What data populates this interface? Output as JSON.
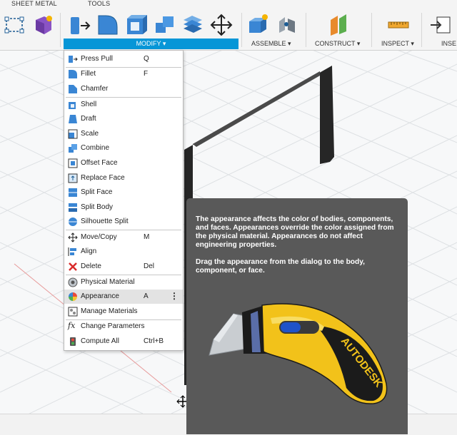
{
  "toolbar": {
    "tabs": [
      "SHEET METAL",
      "TOOLS"
    ],
    "groups": {
      "modify": "MODIFY ▾",
      "assemble": "ASSEMBLE ▾",
      "construct": "CONSTRUCT ▾",
      "inspect": "INSPECT ▾",
      "insert": "INSE"
    }
  },
  "modify_menu": {
    "items": [
      {
        "label": "Press Pull",
        "shortcut": "Q",
        "icon": "press-pull-icon"
      },
      {
        "label": "Fillet",
        "shortcut": "F",
        "icon": "fillet-icon"
      },
      {
        "label": "Chamfer",
        "shortcut": "",
        "icon": "chamfer-icon"
      },
      {
        "label": "Shell",
        "shortcut": "",
        "icon": "shell-icon"
      },
      {
        "label": "Draft",
        "shortcut": "",
        "icon": "draft-icon"
      },
      {
        "label": "Scale",
        "shortcut": "",
        "icon": "scale-icon"
      },
      {
        "label": "Combine",
        "shortcut": "",
        "icon": "combine-icon"
      },
      {
        "label": "Offset Face",
        "shortcut": "",
        "icon": "offset-face-icon"
      },
      {
        "label": "Replace Face",
        "shortcut": "",
        "icon": "replace-face-icon"
      },
      {
        "label": "Split Face",
        "shortcut": "",
        "icon": "split-face-icon"
      },
      {
        "label": "Split Body",
        "shortcut": "",
        "icon": "split-body-icon"
      },
      {
        "label": "Silhouette Split",
        "shortcut": "",
        "icon": "silhouette-split-icon"
      },
      {
        "label": "Move/Copy",
        "shortcut": "M",
        "icon": "move-icon"
      },
      {
        "label": "Align",
        "shortcut": "",
        "icon": "align-icon"
      },
      {
        "label": "Delete",
        "shortcut": "Del",
        "icon": "delete-icon"
      },
      {
        "label": "Physical Material",
        "shortcut": "",
        "icon": "physical-material-icon"
      },
      {
        "label": "Appearance",
        "shortcut": "A",
        "icon": "appearance-icon"
      },
      {
        "label": "Manage Materials",
        "shortcut": "",
        "icon": "manage-materials-icon"
      },
      {
        "label": "Change Parameters",
        "shortcut": "",
        "icon": "fx-icon"
      },
      {
        "label": "Compute All",
        "shortcut": "Ctrl+B",
        "icon": "compute-all-icon"
      }
    ]
  },
  "tooltip": {
    "paragraph1": "The appearance affects the color of bodies, components, and faces. Appearances override the color assigned from the physical material. Appearances do not affect engineering properties.",
    "paragraph2": "Drag the appearance from the dialog to the body, component, or face.",
    "brand": "AUTODESK"
  },
  "colors": {
    "accent": "#0696d7",
    "tooltip_bg": "#595959",
    "delete_red": "#d92b2b"
  }
}
